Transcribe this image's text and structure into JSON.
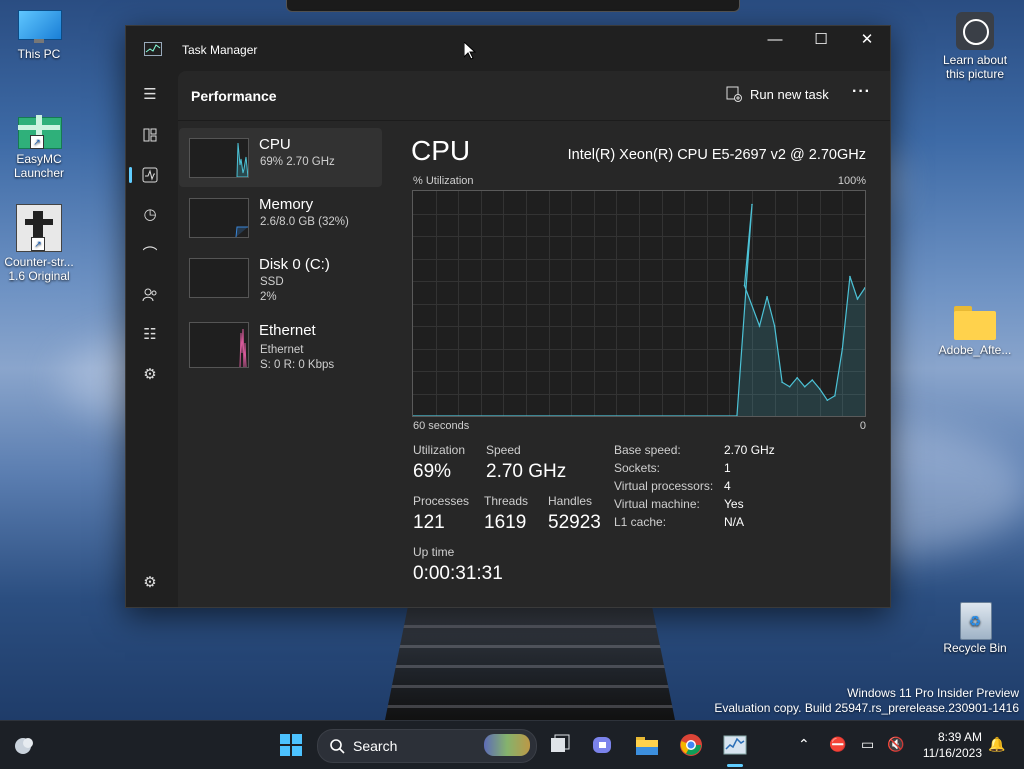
{
  "desktop": {
    "icons": [
      {
        "name": "this-pc",
        "label": "This PC"
      },
      {
        "name": "easymc",
        "label": "EasyMC Launcher"
      },
      {
        "name": "counter-strike",
        "label": "Counter-str... 1.6 Original"
      },
      {
        "name": "learn-about",
        "label": "Learn about this picture"
      },
      {
        "name": "adobe",
        "label": "Adobe_Afte..."
      },
      {
        "name": "recycle-bin",
        "label": "Recycle Bin"
      }
    ],
    "watermark_line1": "Windows 11 Pro Insider Preview",
    "watermark_line2": "Evaluation copy. Build 25947.rs_prerelease.230901-1416"
  },
  "window": {
    "title": "Task Manager",
    "minimize": "—",
    "maximize": "☐",
    "close": "✕"
  },
  "header": {
    "page_title": "Performance",
    "run_new_task": "Run new task",
    "more": "···"
  },
  "nav_icons": [
    "hamburger-icon",
    "processes-icon",
    "performance-icon",
    "app-history-icon",
    "startup-apps-icon",
    "users-icon",
    "details-icon",
    "services-icon",
    "settings-icon"
  ],
  "devices": [
    {
      "name": "CPU",
      "line1": "69% 2.70 GHz",
      "line2": "",
      "color": "#4cc2d6"
    },
    {
      "name": "Memory",
      "line1": "2.6/8.0 GB (32%)",
      "line2": "",
      "color": "#3a86d8"
    },
    {
      "name": "Disk 0 (C:)",
      "line1": "SSD",
      "line2": "2%",
      "color": "#55b24a"
    },
    {
      "name": "Ethernet",
      "line1": "Ethernet",
      "line2": "S: 0 R: 0 Kbps",
      "color": "#d65a9a"
    }
  ],
  "cpu": {
    "title": "CPU",
    "model": "Intel(R) Xeon(R) CPU E5-2697 v2 @ 2.70GHz",
    "util_label": "% Utilization",
    "util_max": "100%",
    "time_label": "60 seconds",
    "time_min": "0",
    "stats": {
      "utilization_label": "Utilization",
      "utilization": "69%",
      "speed_label": "Speed",
      "speed": "2.70 GHz",
      "processes_label": "Processes",
      "processes": "121",
      "threads_label": "Threads",
      "threads": "1619",
      "handles_label": "Handles",
      "handles": "52923",
      "uptime_label": "Up time",
      "uptime": "0:00:31:31"
    },
    "specs": [
      {
        "k": "Base speed:",
        "v": "2.70 GHz"
      },
      {
        "k": "Sockets:",
        "v": "1"
      },
      {
        "k": "Virtual processors:",
        "v": "4"
      },
      {
        "k": "Virtual machine:",
        "v": "Yes"
      },
      {
        "k": "L1 cache:",
        "v": "N/A"
      }
    ]
  },
  "chart_data": {
    "type": "area",
    "title": "CPU",
    "ylabel": "% Utilization",
    "xlabel": "60 seconds",
    "ylim": [
      0,
      100
    ],
    "xlim": [
      60,
      0
    ],
    "color": "#4cc2d6",
    "x": [
      60,
      17,
      15,
      16,
      14,
      13,
      12,
      11,
      10,
      9,
      8,
      7,
      6,
      5,
      4,
      3,
      2,
      1,
      0
    ],
    "values": [
      0,
      0,
      94,
      58,
      40,
      53,
      40,
      15,
      13,
      17,
      13,
      16,
      12,
      7,
      9,
      30,
      62,
      52,
      57
    ]
  },
  "taskbar": {
    "search_label": "Search",
    "time": "8:39 AM",
    "date": "11/16/2023"
  }
}
